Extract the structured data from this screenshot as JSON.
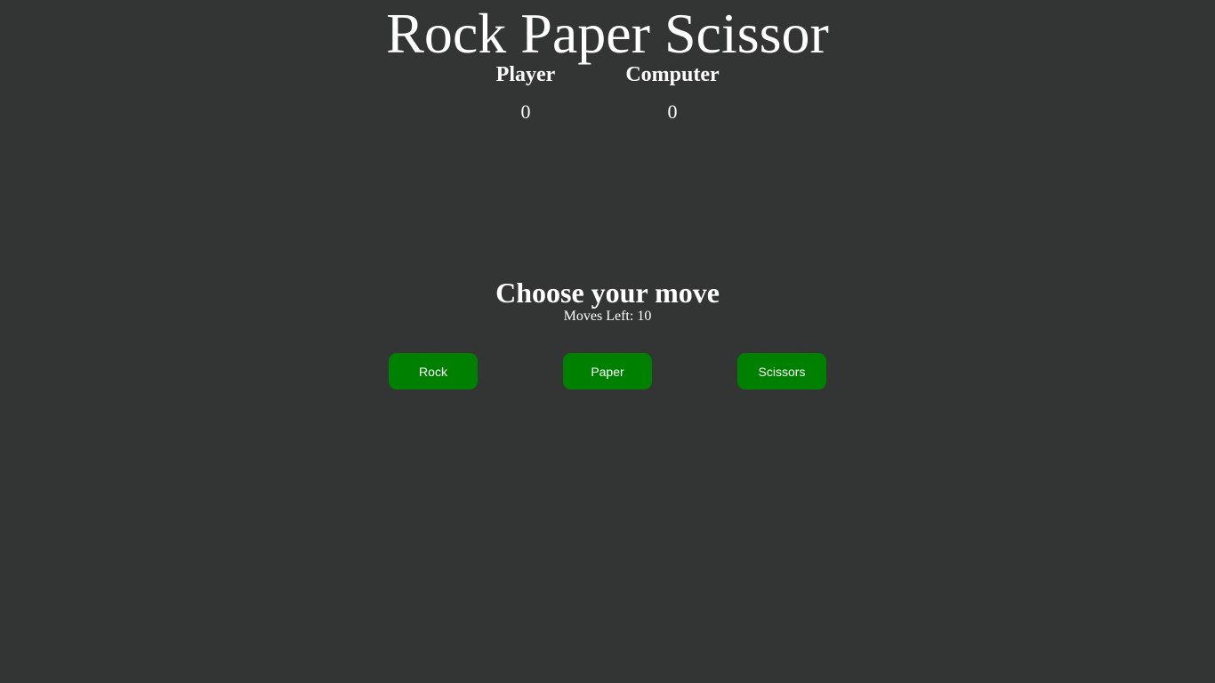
{
  "game": {
    "title": "Rock Paper Scissor",
    "scoreboard": {
      "player_label": "Player",
      "computer_label": "Computer",
      "player_score": "0",
      "computer_score": "0"
    },
    "prompt": "Choose your move",
    "moves_left_label": "Moves Left: 10",
    "buttons": {
      "rock": "Rock",
      "paper": "Paper",
      "scissors": "Scissors"
    }
  },
  "colors": {
    "background": "#333434",
    "button": "#008000",
    "text": "#ffffff"
  }
}
